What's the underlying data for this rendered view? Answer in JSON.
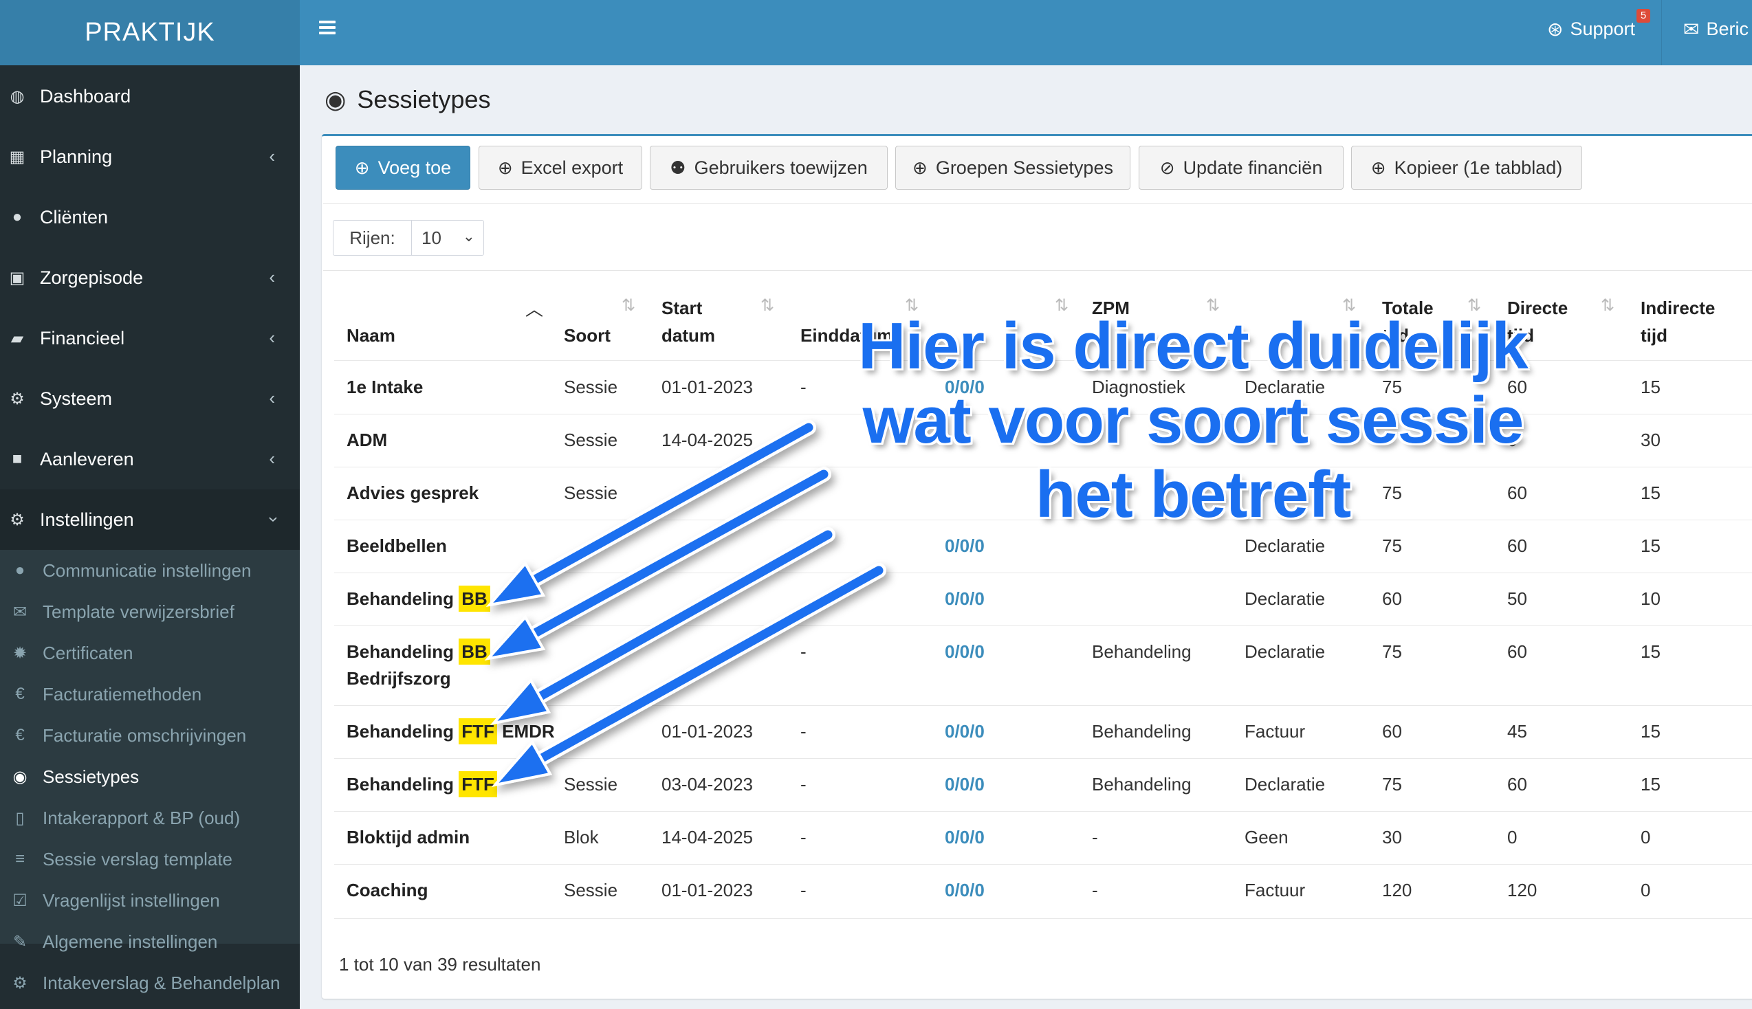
{
  "app": {
    "title": "PRAKTIJK"
  },
  "header": {
    "support_label": "Support",
    "support_badge": "5",
    "messages_label": "Beric"
  },
  "sidebar": {
    "items": [
      {
        "label": "Dashboard",
        "icon": "dashboard-icon"
      },
      {
        "label": "Planning",
        "icon": "calendar-icon"
      },
      {
        "label": "Cliënten",
        "icon": "user-icon"
      },
      {
        "label": "Zorgepisode",
        "icon": "briefcase-icon"
      },
      {
        "label": "Financieel",
        "icon": "book-icon"
      },
      {
        "label": "Systeem",
        "icon": "cogs-icon"
      },
      {
        "label": "Aanleveren",
        "icon": "truck-icon"
      },
      {
        "label": "Instellingen",
        "icon": "gear-icon"
      }
    ],
    "subitems": [
      {
        "label": "Communicatie instellingen",
        "icon": "comments-icon"
      },
      {
        "label": "Template verwijzersbrief",
        "icon": "envelope-icon"
      },
      {
        "label": "Certificaten",
        "icon": "certificate-icon"
      },
      {
        "label": "Facturatiemethoden",
        "icon": "euro-icon"
      },
      {
        "label": "Facturatie omschrijvingen",
        "icon": "euro-icon"
      },
      {
        "label": "Sessietypes",
        "icon": "globe-icon"
      },
      {
        "label": "Intakerapport & BP (oud)",
        "icon": "file-icon"
      },
      {
        "label": "Sessie verslag template",
        "icon": "list-icon"
      },
      {
        "label": "Vragenlijst instellingen",
        "icon": "check-square-icon"
      },
      {
        "label": "Algemene instellingen",
        "icon": "wrench-icon"
      },
      {
        "label": "Intakeverslag & Behandelplan",
        "icon": "gear-icon"
      }
    ]
  },
  "page": {
    "title": "Sessietypes"
  },
  "toolbar": {
    "add": "Voeg toe",
    "excel": "Excel export",
    "assign_users": "Gebruikers toewijzen",
    "groups": "Groepen Sessietypes",
    "update_fin": "Update financiën",
    "copy": "Kopieer (1e tabblad)"
  },
  "rows_control": {
    "label": "Rijen:",
    "value": "10"
  },
  "table": {
    "headers": {
      "naam": "Naam",
      "soort": "Soort",
      "start_1": "Start",
      "start_2": "datum",
      "eind": "Einddatum",
      "zpm_1": "ZPM",
      "totale_1": "Totale",
      "tijd": "tijd",
      "directe_1": "Directe",
      "indirecte_1": "Indirecte"
    },
    "rows": [
      {
        "naam": "1e Intake",
        "soort": "Sessie",
        "start": "01-01-2023",
        "eind": "-",
        "code": "0/0/0",
        "zpm": "Diagnostiek",
        "fact": "Declaratie",
        "tot": "75",
        "dir": "60",
        "ind": "15"
      },
      {
        "naam": "ADM",
        "soort": "Sessie",
        "start": "14-04-2025",
        "tot": "",
        "dir": "0",
        "ind": "30"
      },
      {
        "naam": "Advies gesprek",
        "soort": "Sessie",
        "tot": "75",
        "dir": "60",
        "ind": "15"
      },
      {
        "naam": "Beeldbellen",
        "code": "0/0/0",
        "fact": "Declaratie",
        "tot": "75",
        "dir": "60",
        "ind": "15"
      },
      {
        "naam_a": "Behandeling ",
        "naam_hl": "BB",
        "code": "0/0/0",
        "fact": "Declaratie",
        "tot": "60",
        "dir": "50",
        "ind": "10"
      },
      {
        "naam_a": "Behandeling ",
        "naam_hl": "BB",
        "naam_2": "Bedrijfszorg",
        "eind": "-",
        "code": "0/0/0",
        "zpm": "Behandeling",
        "fact": "Declaratie",
        "tot": "75",
        "dir": "60",
        "ind": "15"
      },
      {
        "naam_a": "Behandeling ",
        "naam_hl": "FTF",
        "naam_b": " EMDR",
        "start": "01-01-2023",
        "eind": "-",
        "code": "0/0/0",
        "zpm": "Behandeling",
        "fact": "Factuur",
        "tot": "60",
        "dir": "45",
        "ind": "15"
      },
      {
        "naam_a": "Behandeling ",
        "naam_hl": "FTF",
        "soort": "Sessie",
        "start": "03-04-2023",
        "eind": "-",
        "code": "0/0/0",
        "zpm": "Behandeling",
        "fact": "Declaratie",
        "tot": "75",
        "dir": "60",
        "ind": "15"
      },
      {
        "naam": "Bloktijd admin",
        "soort": "Blok",
        "start": "14-04-2025",
        "eind": "-",
        "code": "0/0/0",
        "zpm": "-",
        "fact": "Geen",
        "tot": "30",
        "dir": "0",
        "ind": "0"
      },
      {
        "naam": "Coaching",
        "soort": "Sessie",
        "start": "01-01-2023",
        "eind": "-",
        "code": "0/0/0",
        "zpm": "-",
        "fact": "Factuur",
        "tot": "120",
        "dir": "120",
        "ind": "0"
      }
    ],
    "footer": "1 tot 10 van 39 resultaten"
  },
  "annotation": {
    "text": "Hier is direct duidelijk wat voor soort sessie het betreft",
    "color": "#1a6ff0"
  }
}
